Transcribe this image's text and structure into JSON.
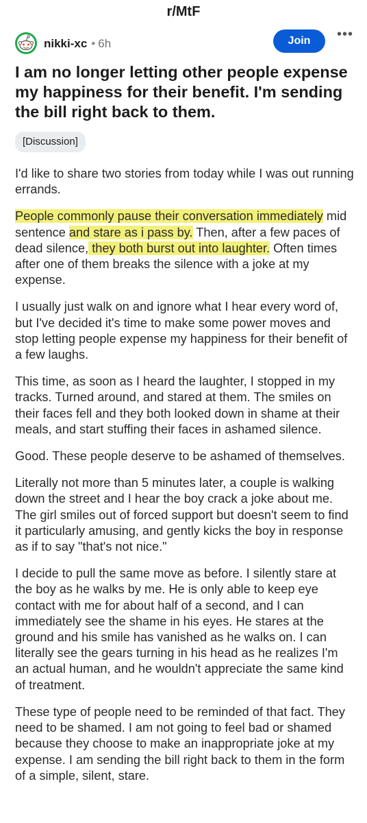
{
  "header": {
    "subreddit": "r/MtF"
  },
  "post": {
    "author": "nikki-xc",
    "separator": "•",
    "age": "6h",
    "join_label": "Join",
    "more_label": "•••",
    "title": "I am no longer letting other people expense my happiness for their benefit. I'm sending the bill right back to them.",
    "flair": "[Discussion]",
    "p1": "I'd like to share two stories from today while I was out running errands.",
    "p2": {
      "a": "People commonly pause their conversation immediately",
      "b": " mid sentence ",
      "c": "and stare as i pass by.",
      "d": " Then, after a few paces of dead silence,",
      "e": " they both burst out into laughter.",
      "f": " Often times after one of them breaks the silence with a joke at my expense."
    },
    "p3": "I usually just walk on and ignore what I hear every word of, but I've decided it's time to make some power moves and stop letting people expense my happiness for their benefit of a few laughs.",
    "p4": "This time, as soon as I heard the laughter, I stopped in my tracks. Turned around, and stared at them. The smiles on their faces fell and they both looked down in shame at their meals, and start stuffing their faces in ashamed silence.",
    "p5": "Good. These people deserve to be ashamed of themselves.",
    "p6": "Literally not more than 5 minutes later, a couple is walking down the street and I hear the boy crack a joke about me. The girl smiles out of forced support but doesn't seem to find it particularly amusing, and gently kicks the boy in response as if to say \"that's not nice.\"",
    "p7": "I decide to pull the same move as before. I silently stare at the boy as he walks by me. He is only able to keep eye contact with me for about half of a second, and I can immediately see the shame in his eyes. He stares at the ground and his smile has vanished as he walks on. I can literally see the gears turning in his head as he realizes I'm an actual human, and he wouldn't appreciate the same kind of treatment.",
    "p8": "These type of people need to be reminded of that fact. They need to be shamed. I am not going to feel bad or shamed because they choose to make an inappropriate joke at my expense. I am sending the bill right back to them in the form of a simple, silent, stare."
  },
  "colors": {
    "join_button": "#0a5bd6",
    "highlight": "#f3f07a",
    "avatar_ring": "#1fa84a",
    "flair_bg": "#eaedef"
  },
  "icons": {
    "avatar": "reddit-snoo-avatar-icon",
    "more": "more-options-icon"
  }
}
